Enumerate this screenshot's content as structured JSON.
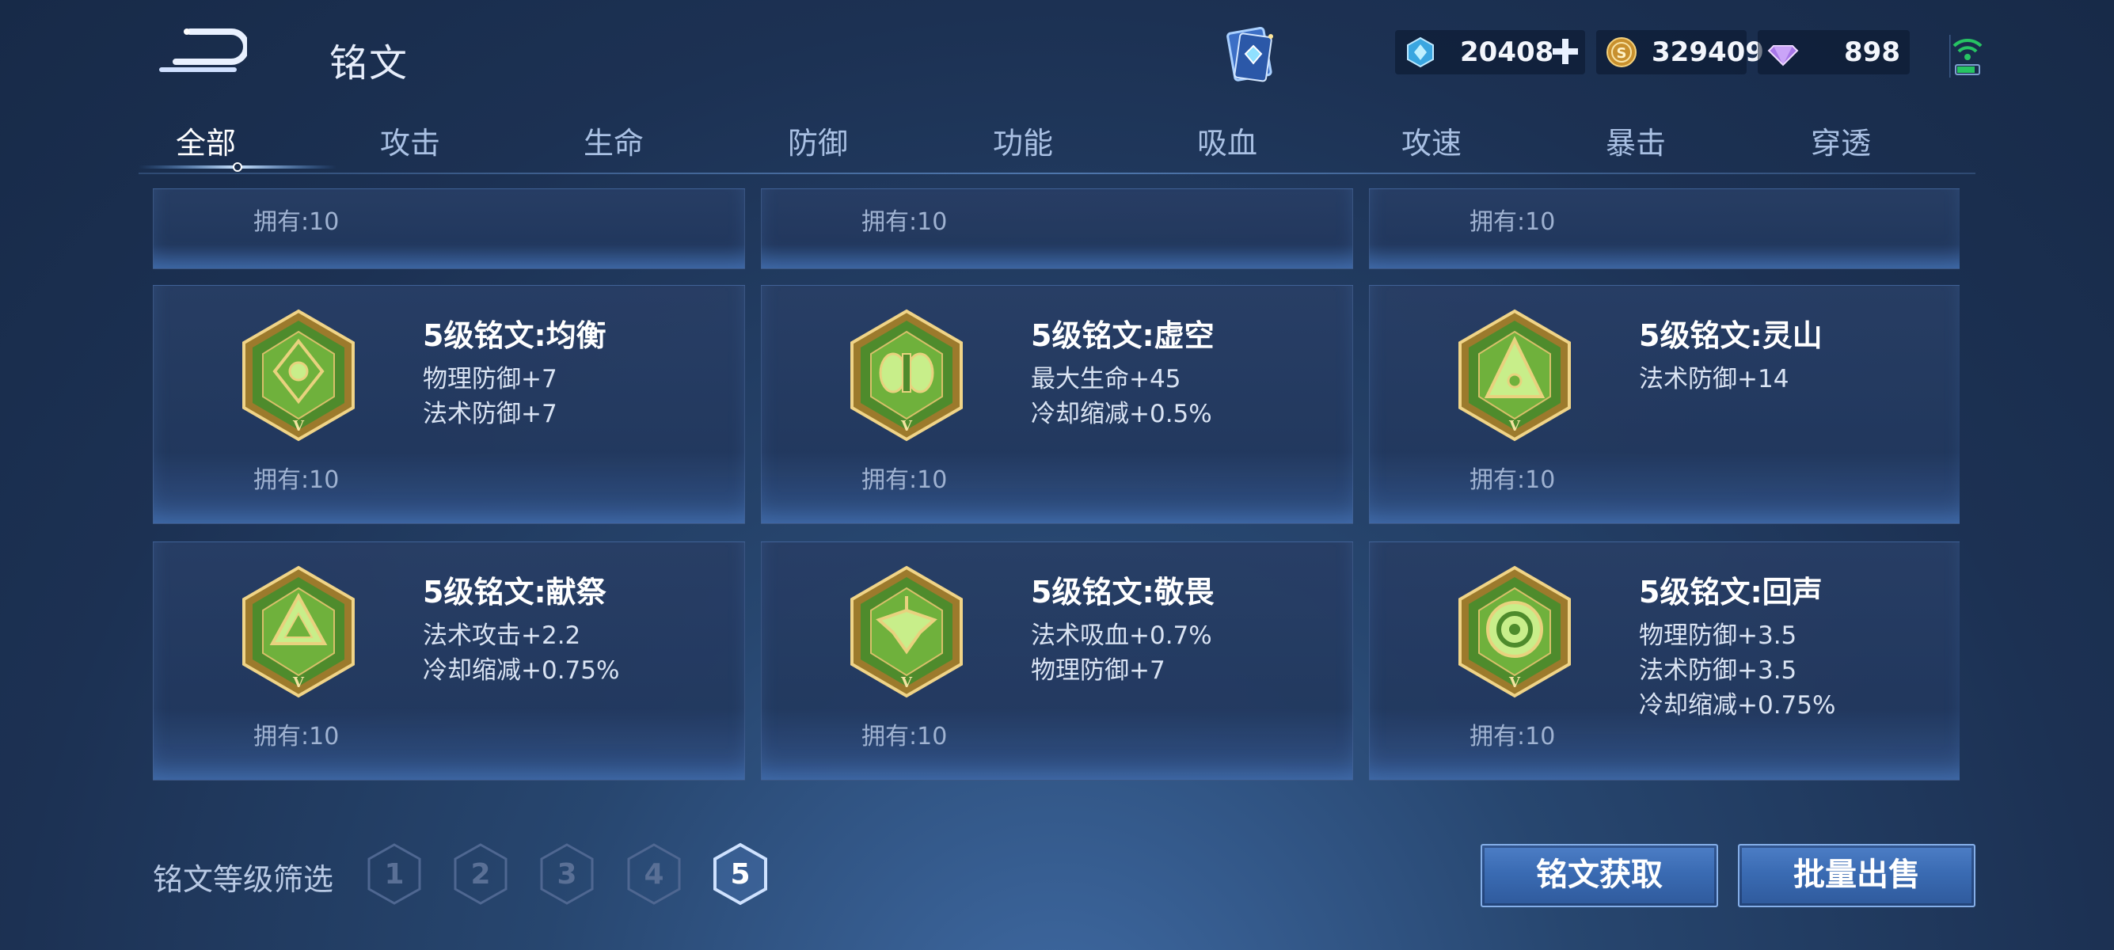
{
  "header": {
    "title": "铭文",
    "back_icon": "back-arrow-icon",
    "bag_icon": "rune-book-icon"
  },
  "currencies": {
    "gem": {
      "value": "20408",
      "icon": "crystal-gem-icon",
      "color": "#49b6e8"
    },
    "gold": {
      "value": "329409",
      "icon": "gold-coin-icon",
      "color": "#d6a041"
    },
    "diamond": {
      "value": "898",
      "icon": "diamond-icon",
      "color": "#b78bf0"
    },
    "signal_icon": "wifi-signal-icon"
  },
  "tabs": [
    {
      "label": "全部",
      "active": true
    },
    {
      "label": "攻击"
    },
    {
      "label": "生命"
    },
    {
      "label": "防御"
    },
    {
      "label": "功能"
    },
    {
      "label": "吸血"
    },
    {
      "label": "攻速"
    },
    {
      "label": "暴击"
    },
    {
      "label": "穿透"
    }
  ],
  "partial_cards": [
    {
      "owned": "拥有:10"
    },
    {
      "owned": "拥有:10"
    },
    {
      "owned": "拥有:10"
    }
  ],
  "runes": [
    {
      "name": "5级铭文:均衡",
      "stats": [
        "物理防御+7",
        "法术防御+7"
      ],
      "owned": "拥有:10",
      "icon": "rune-balance-icon"
    },
    {
      "name": "5级铭文:虚空",
      "stats": [
        "最大生命+45",
        "冷却缩减+0.5%"
      ],
      "owned": "拥有:10",
      "icon": "rune-void-icon"
    },
    {
      "name": "5级铭文:灵山",
      "stats": [
        "法术防御+14"
      ],
      "owned": "拥有:10",
      "icon": "rune-mountain-icon"
    },
    {
      "name": "5级铭文:献祭",
      "stats": [
        "法术攻击+2.2",
        "冷却缩减+0.75%"
      ],
      "owned": "拥有:10",
      "icon": "rune-sacrifice-icon"
    },
    {
      "name": "5级铭文:敬畏",
      "stats": [
        "法术吸血+0.7%",
        "物理防御+7"
      ],
      "owned": "拥有:10",
      "icon": "rune-awe-icon"
    },
    {
      "name": "5级铭文:回声",
      "stats": [
        "物理防御+3.5",
        "法术防御+3.5",
        "冷却缩减+0.75%"
      ],
      "owned": "拥有:10",
      "icon": "rune-echo-icon"
    }
  ],
  "rune_level_roman": "V",
  "filter": {
    "label": "铭文等级筛选",
    "levels": [
      "1",
      "2",
      "3",
      "4",
      "5"
    ],
    "selected": "5"
  },
  "actions": {
    "get_label": "铭文获取",
    "sell_label": "批量出售"
  }
}
